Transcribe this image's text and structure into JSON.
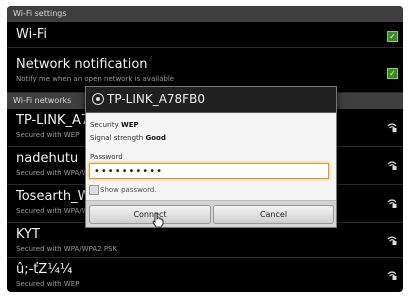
{
  "settings": {
    "header": "Wi-Fi settings",
    "wifi_label": "Wi-Fi",
    "notification_title": "Network notification",
    "notification_subtitle": "Notify me when an open network is available"
  },
  "networks": {
    "header": "Wi-Fi networks",
    "items": [
      {
        "name": "TP-LINK_A78F",
        "security": "Secured with WEP"
      },
      {
        "name": "nadehutu",
        "security": "Secured with WPA/W"
      },
      {
        "name": "Tosearth_WiF",
        "security": "Secured with WPA/W"
      },
      {
        "name": "KYT",
        "security": "Secured with WPA/WPA2 PSK"
      },
      {
        "name": "û;-ťZ¼¼",
        "security": "Secured with WEP"
      }
    ]
  },
  "dialog": {
    "title": "TP-LINK_A78FB0",
    "security_label": "Security",
    "security_value": "WEP",
    "signal_label": "Signal strength",
    "signal_value": "Good",
    "password_label": "Password",
    "password_value": "••••••••••",
    "show_password_label": "Show password.",
    "connect_label": "Connect",
    "cancel_label": "Cancel"
  },
  "icons": {
    "checkbox": "check-icon",
    "signal": "wifi-signal-locked-icon",
    "network": "wifi-network-icon",
    "pointer": "hand-pointer-icon"
  },
  "colors": {
    "check_green": "#3d8a2a",
    "password_focus": "#e09a2a"
  }
}
